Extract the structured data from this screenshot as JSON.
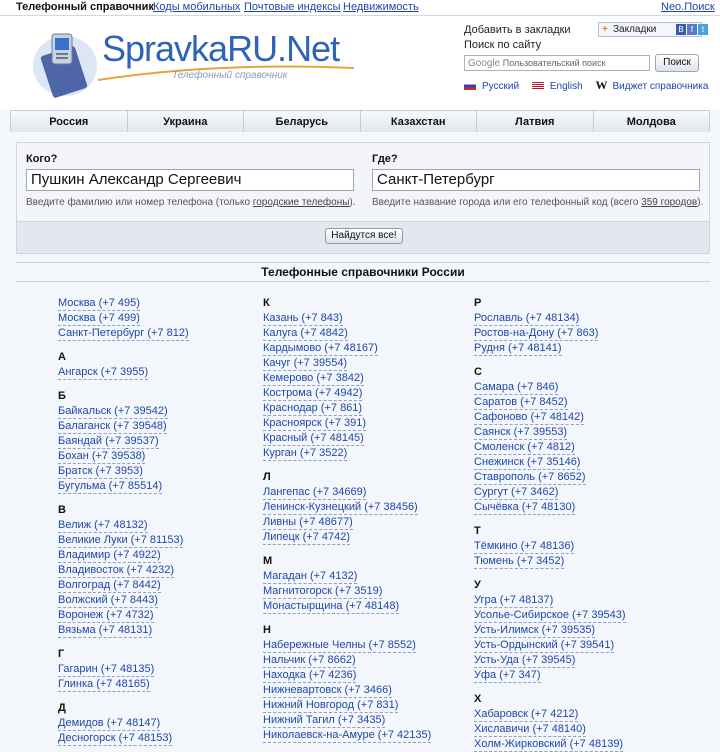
{
  "topbar": {
    "title": "Телефонный справочник",
    "links": [
      "Коды мобильных",
      "Почтовые индексы",
      "Недвижимость"
    ],
    "right_link": "Neo.Поиск"
  },
  "logo": {
    "text": "SpravkaRU.Net",
    "subtitle": "Телефонный справочник"
  },
  "header": {
    "bookmark_link": "Добавить в закладки",
    "bookmark_button": "Закладки",
    "search_label": "Поиск по сайту",
    "search_placeholder": "Пользовательский поиск",
    "search_google": "Google",
    "search_button": "Поиск",
    "langs": [
      "Русский",
      "English",
      "Виджет справочника"
    ]
  },
  "nav": {
    "tabs": [
      "Россия",
      "Украина",
      "Беларусь",
      "Казахстан",
      "Латвия",
      "Молдова"
    ]
  },
  "form": {
    "who_label": "Кого?",
    "who_value": "Пушкин Александр Сергеевич",
    "who_hint_pre": "Введите фамилию или номер телефона (только ",
    "who_hint_link": "городские телефоны",
    "who_hint_post": ").",
    "where_label": "Где?",
    "where_value": "Санкт-Петербург",
    "where_hint_pre": "Введите название города или его телефонный код (всего ",
    "where_hint_link": "359 городов",
    "where_hint_post": ").",
    "submit": "Найдутся все!"
  },
  "section_title": "Телефонные справочники России",
  "columns": [
    [
      {
        "letter": "",
        "cities": [
          "Москва (+7 495)",
          "Москва (+7 499)",
          "Санкт-Петербург (+7 812)"
        ]
      },
      {
        "letter": "А",
        "cities": [
          "Ангарск (+7 3955)"
        ]
      },
      {
        "letter": "Б",
        "cities": [
          "Байкальск (+7 39542)",
          "Балаганск (+7 39548)",
          "Баяндай (+7 39537)",
          "Бохан (+7 39538)",
          "Братск (+7 3953)",
          "Бугульма (+7 85514)"
        ]
      },
      {
        "letter": "В",
        "cities": [
          "Велиж (+7 48132)",
          "Великие Луки (+7 81153)",
          "Владимир (+7 4922)",
          "Владивосток (+7 4232)",
          "Волгоград (+7 8442)",
          "Волжский (+7 8443)",
          "Воронеж (+7 4732)",
          "Вязьма (+7 48131)"
        ]
      },
      {
        "letter": "Г",
        "cities": [
          "Гагарин (+7 48135)",
          "Глинка (+7 48165)"
        ]
      },
      {
        "letter": "Д",
        "cities": [
          "Демидов (+7 48147)",
          "Десногорск (+7 48153)"
        ]
      }
    ],
    [
      {
        "letter": "К",
        "cities": [
          "Казань (+7 843)",
          "Калуга (+7 4842)",
          "Кардымово (+7 48167)",
          "Качуг (+7 39554)",
          "Кемерово (+7 3842)",
          "Кострома (+7 4942)",
          "Краснодар (+7 861)",
          "Красноярск (+7 391)",
          "Красный (+7 48145)",
          "Курган (+7 3522)"
        ]
      },
      {
        "letter": "Л",
        "cities": [
          "Лангепас (+7 34669)",
          "Ленинск-Кузнецкий (+7 38456)",
          "Ливны (+7 48677)",
          "Липецк (+7 4742)"
        ]
      },
      {
        "letter": "М",
        "cities": [
          "Магадан (+7 4132)",
          "Магнитогорск (+7 3519)",
          "Монастырщина (+7 48148)"
        ]
      },
      {
        "letter": "Н",
        "cities": [
          "Набережные Челны (+7 8552)",
          "Нальчик (+7 8662)",
          "Находка (+7 4236)",
          "Нижневартовск (+7 3466)",
          "Нижний Новгород (+7 831)",
          "Нижний Тагил (+7 3435)",
          "Николаевск-на-Амуре (+7 42135)"
        ]
      }
    ],
    [
      {
        "letter": "Р",
        "cities": [
          "Рославль (+7 48134)",
          "Ростов-на-Дону (+7 863)",
          "Рудня (+7 48141)"
        ]
      },
      {
        "letter": "С",
        "cities": [
          "Самара (+7 846)",
          "Саратов (+7 8452)",
          "Сафоново (+7 48142)",
          "Саянск (+7 39553)",
          "Смоленск (+7 4812)",
          "Снежинск (+7 35146)",
          "Ставрополь (+7 8652)",
          "Сургут (+7 3462)",
          "Сычёвка (+7 48130)"
        ]
      },
      {
        "letter": "Т",
        "cities": [
          "Тёмкино (+7 48136)",
          "Тюмень (+7 3452)"
        ]
      },
      {
        "letter": "У",
        "cities": [
          "Угра (+7 48137)",
          "Усолье-Сибирское (+7 39543)",
          "Усть-Илимск (+7 39535)",
          "Усть-Ордынский (+7 39541)",
          "Усть-Уда (+7 39545)",
          "Уфа (+7 347)"
        ]
      },
      {
        "letter": "Х",
        "cities": [
          "Хабаровск (+7 4212)",
          "Хиславичи (+7 48140)",
          "Холм-Жирковский (+7 48139)"
        ]
      }
    ]
  ]
}
